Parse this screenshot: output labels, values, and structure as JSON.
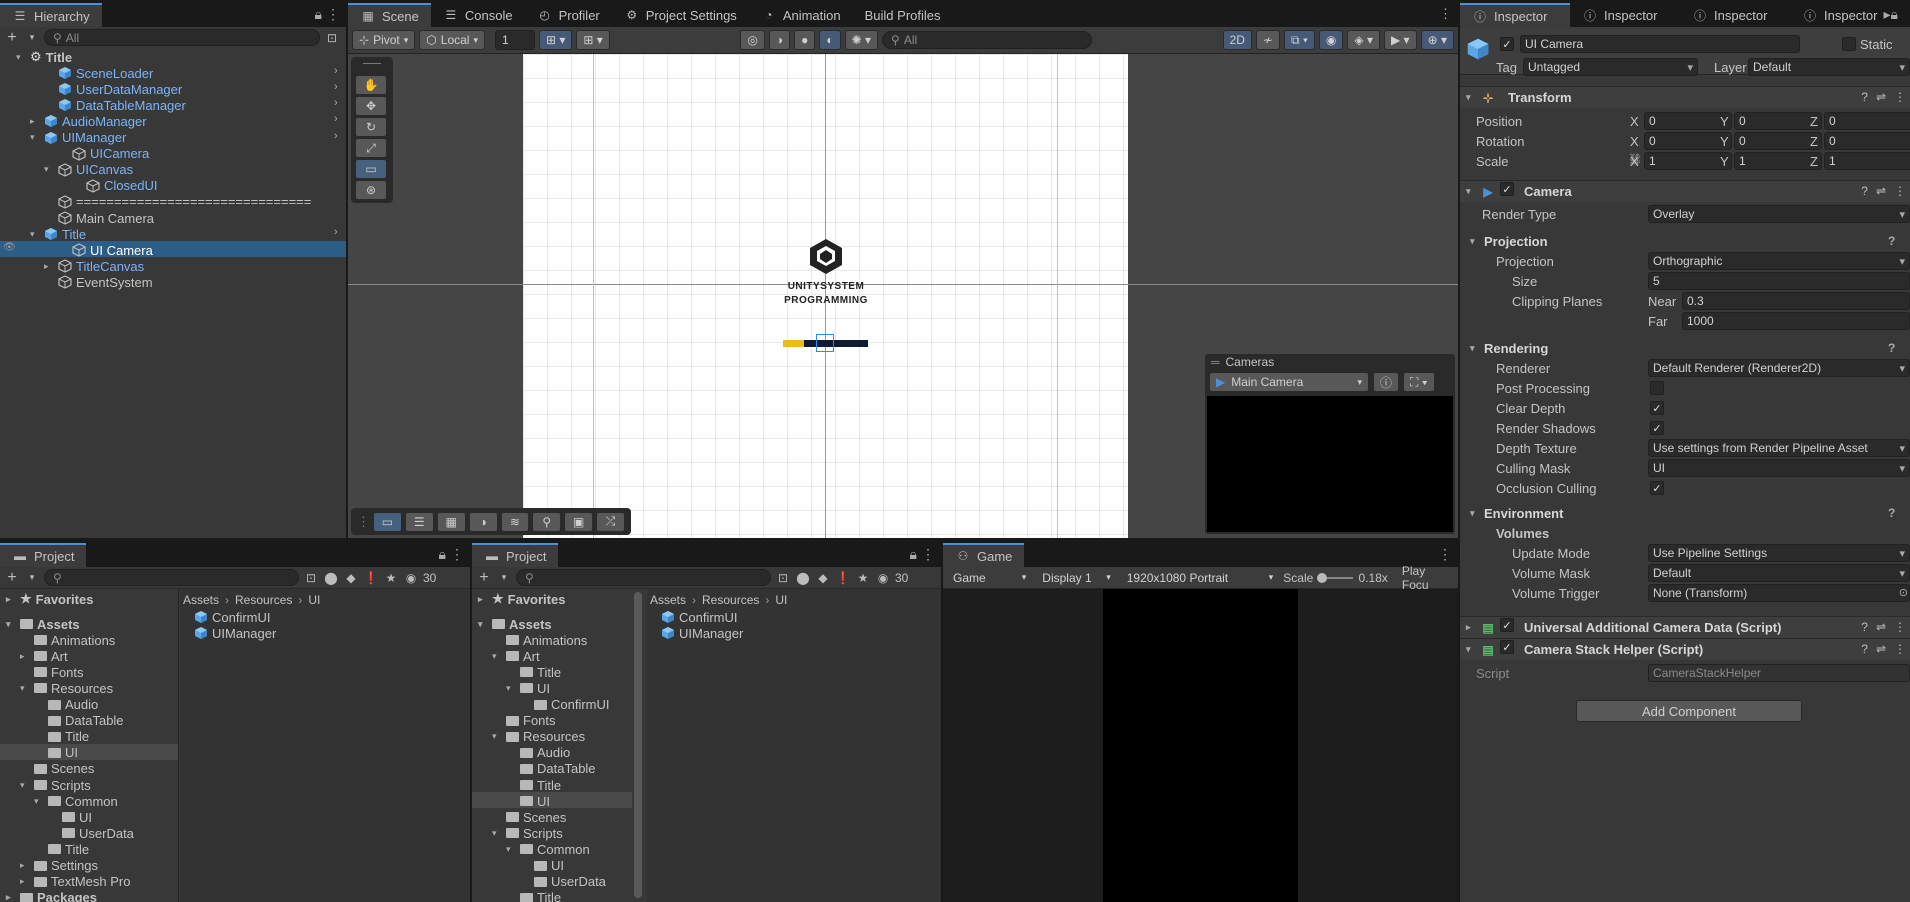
{
  "hierarchy": {
    "tab": "Hierarchy",
    "search_placeholder": "All",
    "rows": [
      {
        "label": "Title",
        "blue": false,
        "bold": true
      },
      {
        "label": "SceneLoader",
        "blue": true
      },
      {
        "label": "UserDataManager",
        "blue": true
      },
      {
        "label": "DataTableManager",
        "blue": true
      },
      {
        "label": "AudioManager",
        "blue": true
      },
      {
        "label": "UIManager",
        "blue": true
      },
      {
        "label": "UICamera",
        "blue": true
      },
      {
        "label": "UICanvas",
        "blue": true
      },
      {
        "label": "ClosedUI",
        "blue": true
      },
      {
        "label": "===============================",
        "blue": false
      },
      {
        "label": "Main Camera",
        "blue": false
      },
      {
        "label": "Title",
        "blue": true
      },
      {
        "label": "UI Camera",
        "blue": false,
        "selected": true
      },
      {
        "label": "TitleCanvas",
        "blue": true
      },
      {
        "label": "EventSystem",
        "blue": false
      }
    ]
  },
  "scene": {
    "tabs": [
      "Scene",
      "Console",
      "Profiler",
      "Project Settings",
      "Animation",
      "Build Profiles"
    ],
    "pivot": "Pivot",
    "local": "Local",
    "grid_value": "1",
    "search_placeholder": "All",
    "mode_2d": "2D",
    "logo_line1": "UNITYSYSTEM",
    "logo_line2": "PROGRAMMING",
    "cameras_overlay": {
      "title": "Cameras",
      "camera": "Main Camera"
    }
  },
  "inspector": {
    "tabs": [
      "Inspector",
      "Inspector",
      "Inspector",
      "Inspector"
    ],
    "object_name": "UI Camera",
    "static_label": "Static",
    "tag_label": "Tag",
    "tag_value": "Untagged",
    "layer_label": "Layer",
    "layer_value": "Default",
    "transform": {
      "title": "Transform",
      "position_label": "Position",
      "rotation_label": "Rotation",
      "scale_label": "Scale",
      "position": {
        "x": "0",
        "y": "0",
        "z": "0"
      },
      "rotation": {
        "x": "0",
        "y": "0",
        "z": "0"
      },
      "scale": {
        "x": "1",
        "y": "1",
        "z": "1"
      }
    },
    "axis": {
      "x": "X",
      "y": "Y",
      "z": "Z"
    },
    "camera": {
      "title": "Camera",
      "render_type_label": "Render Type",
      "render_type": "Overlay",
      "projection_header": "Projection",
      "projection_label": "Projection",
      "projection": "Orthographic",
      "size_label": "Size",
      "size": "5",
      "clipping_label": "Clipping Planes",
      "near_label": "Near",
      "near": "0.3",
      "far_label": "Far",
      "far": "1000",
      "rendering_header": "Rendering",
      "renderer_label": "Renderer",
      "renderer": "Default Renderer (Renderer2D)",
      "post_processing_label": "Post Processing",
      "post_processing": false,
      "clear_depth_label": "Clear Depth",
      "clear_depth": true,
      "render_shadows_label": "Render Shadows",
      "render_shadows": true,
      "depth_texture_label": "Depth Texture",
      "depth_texture": "Use settings from Render Pipeline Asset",
      "culling_mask_label": "Culling Mask",
      "culling_mask": "UI",
      "occlusion_label": "Occlusion Culling",
      "occlusion": true,
      "environment_header": "Environment",
      "volumes_label": "Volumes",
      "update_mode_label": "Update Mode",
      "update_mode": "Use Pipeline Settings",
      "volume_mask_label": "Volume Mask",
      "volume_mask": "Default",
      "volume_trigger_label": "Volume Trigger",
      "volume_trigger": "None (Transform)"
    },
    "uacd_title": "Universal Additional Camera Data (Script)",
    "csh_title": "Camera Stack Helper (Script)",
    "script_label": "Script",
    "script_value": "CameraStackHelper",
    "add_component": "Add Component"
  },
  "project1": {
    "tab": "Project",
    "count": "30",
    "favorites": "Favorites",
    "tree": [
      {
        "label": "Assets",
        "depth": 0,
        "bold": true
      },
      {
        "label": "Animations",
        "depth": 1
      },
      {
        "label": "Art",
        "depth": 1
      },
      {
        "label": "Fonts",
        "depth": 1
      },
      {
        "label": "Resources",
        "depth": 1
      },
      {
        "label": "Audio",
        "depth": 2
      },
      {
        "label": "DataTable",
        "depth": 2
      },
      {
        "label": "Title",
        "depth": 2
      },
      {
        "label": "UI",
        "depth": 2,
        "selected": true
      },
      {
        "label": "Scenes",
        "depth": 1
      },
      {
        "label": "Scripts",
        "depth": 1
      },
      {
        "label": "Common",
        "depth": 2
      },
      {
        "label": "UI",
        "depth": 3
      },
      {
        "label": "UserData",
        "depth": 3
      },
      {
        "label": "Title",
        "depth": 2
      },
      {
        "label": "Settings",
        "depth": 1
      },
      {
        "label": "TextMesh Pro",
        "depth": 1
      },
      {
        "label": "Packages",
        "depth": 0,
        "bold": true
      }
    ],
    "breadcrumb": [
      "Assets",
      "Resources",
      "UI"
    ],
    "files": [
      "ConfirmUI",
      "UIManager"
    ]
  },
  "project2": {
    "tab": "Project",
    "count": "30",
    "favorites": "Favorites",
    "tree": [
      {
        "label": "Assets",
        "depth": 0,
        "bold": true
      },
      {
        "label": "Animations",
        "depth": 1
      },
      {
        "label": "Art",
        "depth": 1
      },
      {
        "label": "Title",
        "depth": 2
      },
      {
        "label": "UI",
        "depth": 2
      },
      {
        "label": "ConfirmUI",
        "depth": 3
      },
      {
        "label": "Fonts",
        "depth": 1
      },
      {
        "label": "Resources",
        "depth": 1
      },
      {
        "label": "Audio",
        "depth": 2
      },
      {
        "label": "DataTable",
        "depth": 2
      },
      {
        "label": "Title",
        "depth": 2
      },
      {
        "label": "UI",
        "depth": 2,
        "selected": true
      },
      {
        "label": "Scenes",
        "depth": 1
      },
      {
        "label": "Scripts",
        "depth": 1
      },
      {
        "label": "Common",
        "depth": 2
      },
      {
        "label": "UI",
        "depth": 3
      },
      {
        "label": "UserData",
        "depth": 3
      },
      {
        "label": "Title",
        "depth": 2
      }
    ],
    "breadcrumb": [
      "Assets",
      "Resources",
      "UI"
    ],
    "files": [
      "ConfirmUI",
      "UIManager"
    ]
  },
  "game": {
    "tab": "Game",
    "mode": "Game",
    "display": "Display 1",
    "resolution": "1920x1080 Portrait",
    "scale_label": "Scale",
    "scale_value": "0.18x",
    "play_focus": "Play Focu"
  },
  "colors": {
    "accent": "#4d8fd8",
    "selection": "#2c5d87",
    "link": "#7cb4f5",
    "panel": "#383838"
  }
}
